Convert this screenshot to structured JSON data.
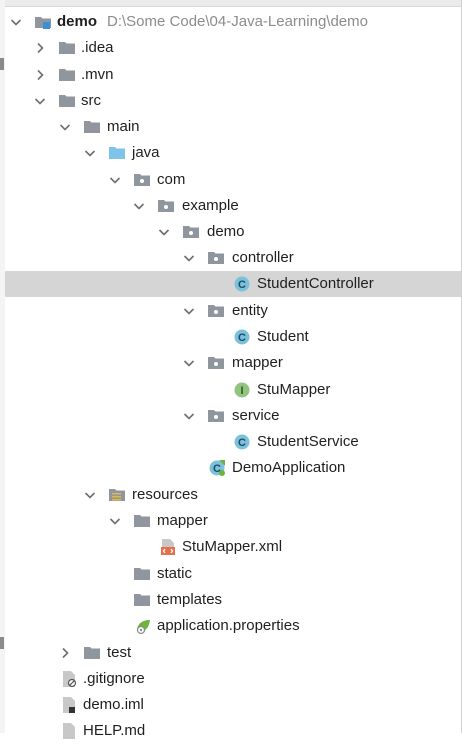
{
  "colors": {
    "folder": "#8f969e",
    "source_folder": "#7ec3e8",
    "class_badge": "#7cc1dc",
    "interface_badge": "#8fc57f",
    "xml": "#e4714b",
    "spring": "#6db33f",
    "selection": "#d5d5d5"
  },
  "tree": {
    "project_name": "demo",
    "project_path": "D:\\Some Code\\04-Java-Learning\\demo",
    "idea": ".idea",
    "mvn": ".mvn",
    "src": "src",
    "main": "main",
    "java": "java",
    "com": "com",
    "example": "example",
    "demo_pkg": "demo",
    "controller": "controller",
    "student_controller": "StudentController",
    "entity": "entity",
    "student": "Student",
    "mapper": "mapper",
    "stu_mapper": "StuMapper",
    "service": "service",
    "student_service": "StudentService",
    "demo_application": "DemoApplication",
    "resources": "resources",
    "res_mapper": "mapper",
    "stu_mapper_xml": "StuMapper.xml",
    "static": "static",
    "templates": "templates",
    "app_properties": "application.properties",
    "test": "test",
    "gitignore": ".gitignore",
    "demo_iml": "demo.iml",
    "help_md": "HELP.md"
  },
  "icons": {
    "expanded": "chevron-down-icon",
    "collapsed": "chevron-right-icon",
    "class_letter": "C",
    "interface_letter": "I"
  }
}
